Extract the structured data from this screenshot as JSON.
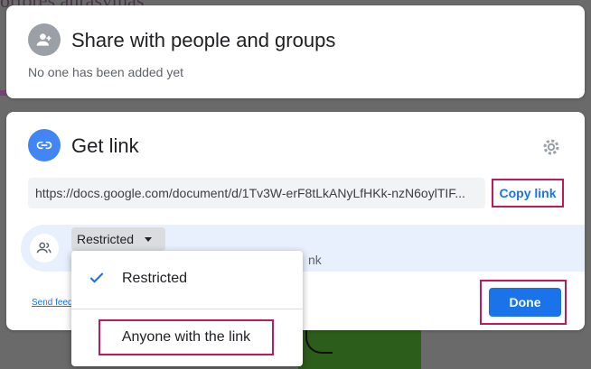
{
  "background": {
    "doc_heading_fragment": "ortores anrasvmas"
  },
  "share_section": {
    "title": "Share with people and groups",
    "subtitle": "No one has been added yet",
    "icon": "add-person-icon"
  },
  "get_link_section": {
    "title": "Get link",
    "icon": "link-icon",
    "settings_icon": "gear-icon",
    "url": "https://docs.google.com/document/d/1Tv3W-erF8tLkANyLfHKk-nzN6oylTIF...",
    "copy_link_label": "Copy link",
    "access": {
      "icon": "people-icon",
      "selected": "Restricted",
      "description_fragment": "nk"
    },
    "feedback_link": "Send feed",
    "done_label": "Done"
  },
  "access_menu": {
    "items": [
      {
        "label": "Restricted",
        "checked": true
      },
      {
        "label": "Anyone with the link",
        "checked": false
      }
    ]
  },
  "colors": {
    "accent": "#1a73e8",
    "highlight_box": "#c2185b",
    "access_row_bg": "#e8f0fe"
  }
}
